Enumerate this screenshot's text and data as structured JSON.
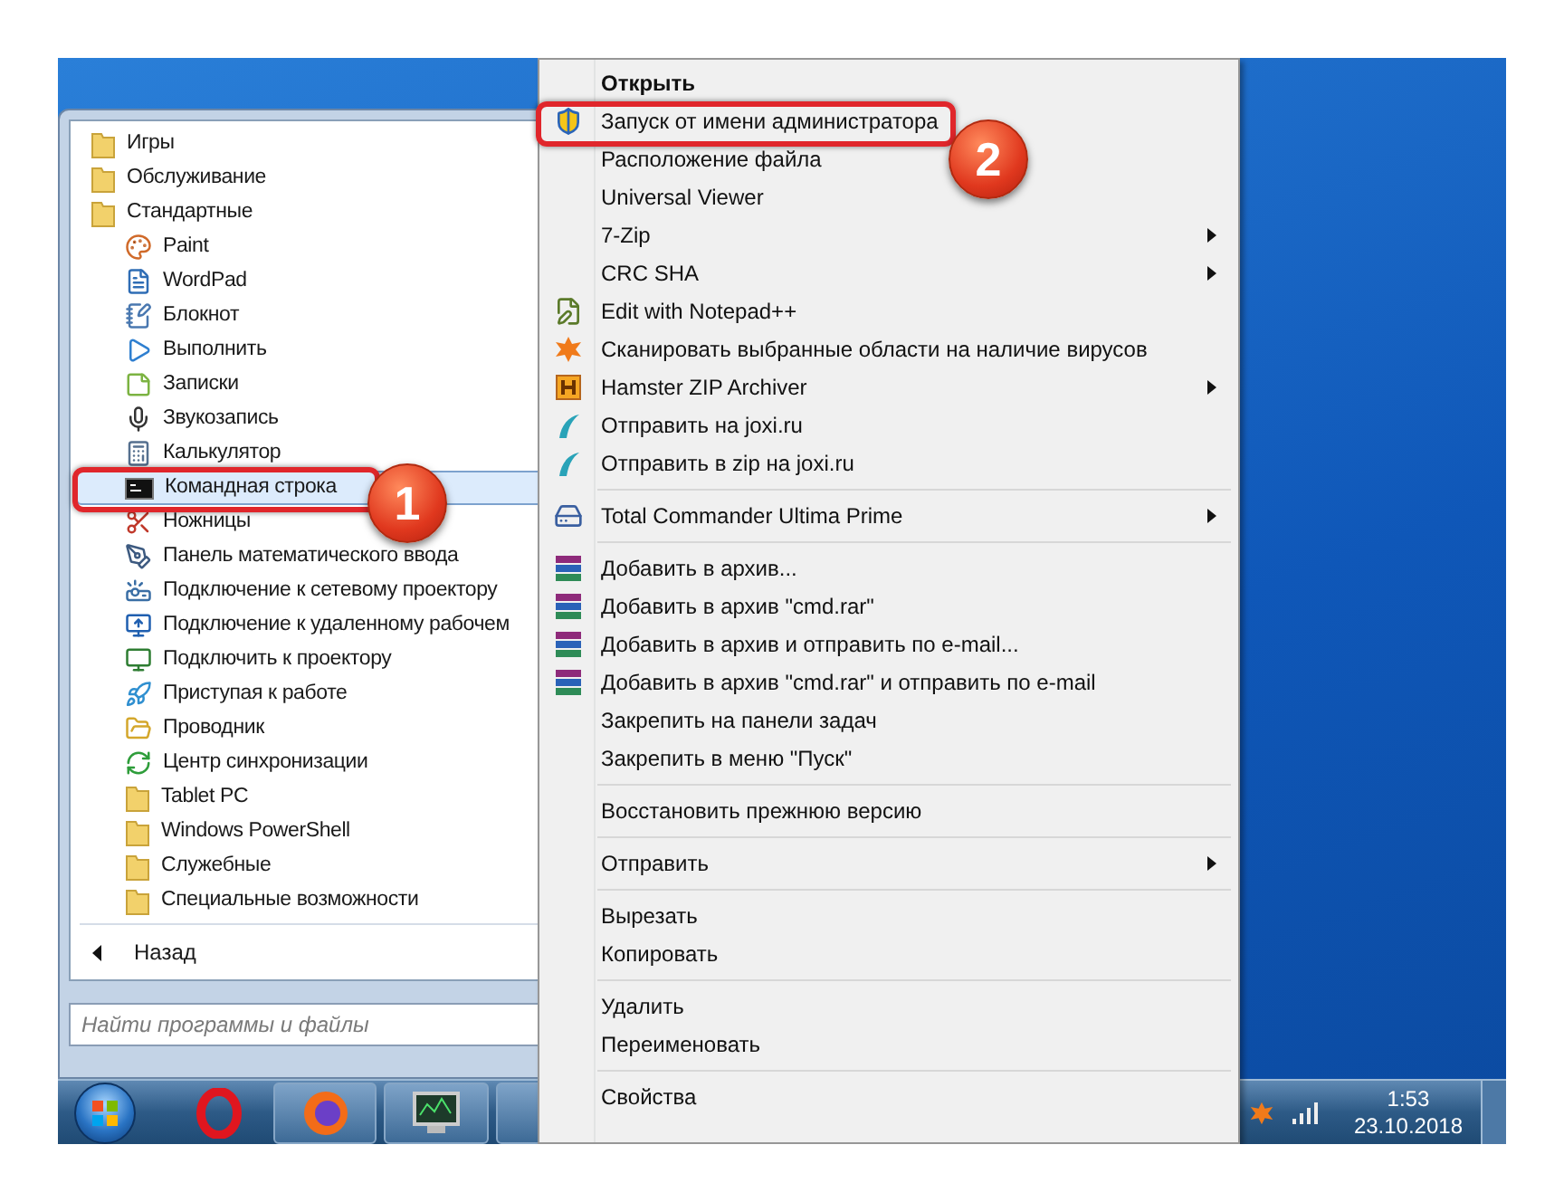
{
  "start_menu": {
    "items": [
      {
        "label": "Игры",
        "kind": "folder",
        "selected": false
      },
      {
        "label": "Обслуживание",
        "kind": "folder",
        "selected": false
      },
      {
        "label": "Стандартные",
        "kind": "folder",
        "selected": false,
        "children": [
          {
            "label": "Paint",
            "kind": "palette",
            "selected": false
          },
          {
            "label": "WordPad",
            "kind": "document",
            "selected": false
          },
          {
            "label": "Блокнот",
            "kind": "notepad",
            "selected": false
          },
          {
            "label": "Выполнить",
            "kind": "run",
            "selected": false
          },
          {
            "label": "Записки",
            "kind": "notes",
            "selected": false
          },
          {
            "label": "Звукозапись",
            "kind": "microphone",
            "selected": false
          },
          {
            "label": "Калькулятор",
            "kind": "calculator",
            "selected": false
          },
          {
            "label": "Командная строка",
            "kind": "console",
            "selected": true
          },
          {
            "label": "Ножницы",
            "kind": "scissors",
            "selected": false
          },
          {
            "label": "Панель математического ввода",
            "kind": "pen",
            "selected": false
          },
          {
            "label": "Подключение к сетевому проектору",
            "kind": "projector",
            "selected": false
          },
          {
            "label": "Подключение к удаленному рабочем",
            "kind": "remote",
            "selected": false
          },
          {
            "label": "Подключить к проектору",
            "kind": "monitor",
            "selected": false
          },
          {
            "label": "Приступая к работе",
            "kind": "start",
            "selected": false
          },
          {
            "label": "Проводник",
            "kind": "explorer",
            "selected": false
          },
          {
            "label": "Центр синхронизации",
            "kind": "sync",
            "selected": false
          },
          {
            "label": "Tablet PC",
            "kind": "folder",
            "selected": false
          },
          {
            "label": "Windows PowerShell",
            "kind": "folder",
            "selected": false
          },
          {
            "label": "Служебные",
            "kind": "folder",
            "selected": false
          },
          {
            "label": "Специальные возможности",
            "kind": "folder",
            "selected": false
          }
        ]
      }
    ],
    "back": {
      "label": "Назад"
    },
    "search": {
      "placeholder": "Найти программы и файлы"
    }
  },
  "context_menu": {
    "items": [
      {
        "kind": "plain",
        "label": "Открыть",
        "default": true,
        "submenu": false
      },
      {
        "kind": "shield",
        "label": "Запуск от имени администратора",
        "default": false,
        "submenu": false
      },
      {
        "kind": "plain",
        "label": "Расположение файла",
        "default": false,
        "submenu": false
      },
      {
        "kind": "plain",
        "label": "Universal Viewer",
        "default": false,
        "submenu": false
      },
      {
        "kind": "plain",
        "label": "7-Zip",
        "default": false,
        "submenu": true
      },
      {
        "kind": "plain",
        "label": "CRC SHA",
        "default": false,
        "submenu": true
      },
      {
        "kind": "notepad",
        "label": "Edit with Notepad++",
        "default": false,
        "submenu": false
      },
      {
        "kind": "scan",
        "label": "Сканировать выбранные области на наличие вирусов",
        "default": false,
        "submenu": false
      },
      {
        "kind": "hamster",
        "label": "Hamster ZIP Archiver",
        "default": false,
        "submenu": true
      },
      {
        "kind": "joxi",
        "label": "Отправить на joxi.ru",
        "default": false,
        "submenu": false
      },
      {
        "kind": "joxi",
        "label": "Отправить в zip на joxi.ru",
        "default": false,
        "submenu": false
      },
      {
        "kind": "separator"
      },
      {
        "kind": "disk",
        "label": "Total Commander Ultima Prime",
        "default": false,
        "submenu": true
      },
      {
        "kind": "separator"
      },
      {
        "kind": "archive",
        "label": "Добавить в архив...",
        "default": false,
        "submenu": false
      },
      {
        "kind": "archive",
        "label": "Добавить в архив \"cmd.rar\"",
        "default": false,
        "submenu": false
      },
      {
        "kind": "archive",
        "label": "Добавить в архив и отправить по e-mail...",
        "default": false,
        "submenu": false
      },
      {
        "kind": "archive",
        "label": "Добавить в архив \"cmd.rar\" и отправить по e-mail",
        "default": false,
        "submenu": false
      },
      {
        "kind": "plain",
        "label": "Закрепить на панели задач",
        "default": false,
        "submenu": false
      },
      {
        "kind": "plain",
        "label": "Закрепить в меню \"Пуск\"",
        "default": false,
        "submenu": false
      },
      {
        "kind": "separator"
      },
      {
        "kind": "plain",
        "label": "Восстановить прежнюю версию",
        "default": false,
        "submenu": false
      },
      {
        "kind": "separator"
      },
      {
        "kind": "plain",
        "label": "Отправить",
        "default": false,
        "submenu": true
      },
      {
        "kind": "separator"
      },
      {
        "kind": "plain",
        "label": "Вырезать",
        "default": false,
        "submenu": false
      },
      {
        "kind": "plain",
        "label": "Копировать",
        "default": false,
        "submenu": false
      },
      {
        "kind": "separator"
      },
      {
        "kind": "plain",
        "label": "Удалить",
        "default": false,
        "submenu": false
      },
      {
        "kind": "plain",
        "label": "Переименовать",
        "default": false,
        "submenu": false
      },
      {
        "kind": "separator"
      },
      {
        "kind": "plain",
        "label": "Свойства",
        "default": false,
        "submenu": false
      }
    ]
  },
  "taskbar": {
    "clock": {
      "time": "1:53",
      "date": "23.10.2018"
    }
  },
  "callouts": [
    {
      "number": "1"
    },
    {
      "number": "2"
    }
  ]
}
